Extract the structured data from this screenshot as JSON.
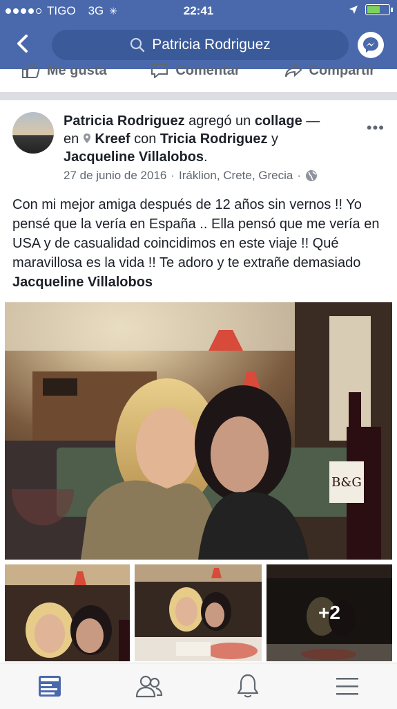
{
  "status": {
    "carrier": "TIGO",
    "network": "3G",
    "time": "22:41",
    "battery_level": 0.65
  },
  "search": {
    "query": "Patricia Rodriguez"
  },
  "actions": {
    "like": "Me gusta",
    "comment": "Comentar",
    "share": "Compartir"
  },
  "post": {
    "author": "Patricia Rodriguez",
    "added": "agregó un",
    "collage": "collage",
    "dash": "—",
    "in": "en",
    "place": "Kreef",
    "with": "con",
    "friend1": "Tricia Rodriguez",
    "and": "y",
    "friend2": "Jacqueline Villalobos",
    "period": ".",
    "date": "27 de junio de 2016",
    "location": "Iráklion, Crete, Grecia",
    "sep": "·",
    "text": "Con mi mejor amiga después de 12 años sin vernos !! Yo pensé que la vería en España .. Ella pensó que me vería en USA y de casualidad coincidimos en este viaje !! Qué maravillosa es la vida !! Te adoro y te extrañe demasiado",
    "text_tag": "Jacqueline Villalobos",
    "more_photos": "+2",
    "bottle_label": "B&G"
  },
  "colors": {
    "brand": "#4a69ad",
    "tab_active": "#4a69ad",
    "tab_inactive": "#606770"
  },
  "icons": [
    "search-icon",
    "back-icon",
    "messenger-icon",
    "like-icon",
    "comment-icon",
    "share-icon",
    "more-icon",
    "location-pin-icon",
    "globe-icon",
    "news-feed-icon",
    "friends-icon",
    "notifications-icon",
    "menu-icon"
  ]
}
